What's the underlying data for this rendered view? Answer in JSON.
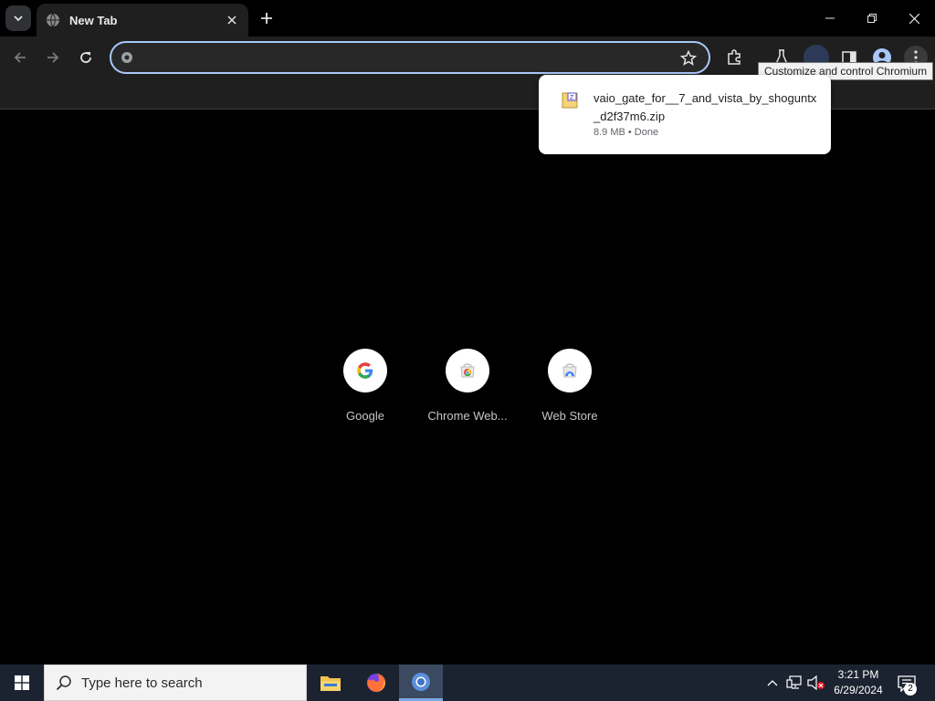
{
  "browser": {
    "tab": {
      "title": "New Tab"
    },
    "omnibox": {
      "value": "",
      "placeholder": ""
    },
    "tooltip": "Customize and control Chromium"
  },
  "download": {
    "filename": "vaio_gate_for__7_and_vista_by_shoguntx_d2f37m6.zip",
    "status": "8.9 MB • Done"
  },
  "shortcuts": [
    {
      "label": "Google",
      "icon": "google-icon"
    },
    {
      "label": "Chrome Web...",
      "icon": "chrome-web-store-icon"
    },
    {
      "label": "Web Store",
      "icon": "web-store-icon"
    }
  ],
  "taskbar": {
    "search_placeholder": "Type here to search",
    "time": "3:21 PM",
    "date": "6/29/2024",
    "notification_count": "2"
  },
  "colors": {
    "accent": "#a8c7fa",
    "taskbar": "#1c2330",
    "toolbar": "#1f1f1f"
  }
}
